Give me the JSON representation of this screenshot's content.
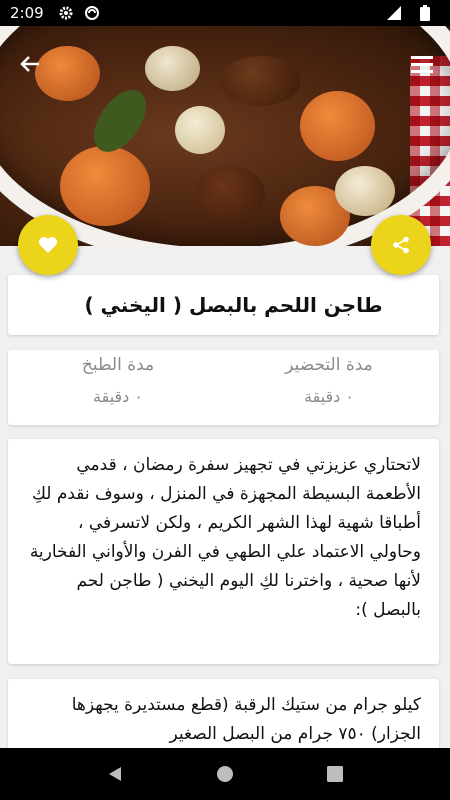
{
  "status_bar": {
    "time": "2:09",
    "icons": [
      "gear-icon",
      "sync-icon",
      "signal-icon",
      "battery-icon"
    ]
  },
  "hero": {
    "image": "beef-stew-photo",
    "back_icon": "arrow-left-icon",
    "menu_icon": "hamburger-menu-icon"
  },
  "actions": {
    "favorite_icon": "heart-icon",
    "share_icon": "share-icon",
    "accent_color": "#ecd41a"
  },
  "recipe": {
    "title": "طاجن اللحم بالبصل ( اليخني )",
    "prep_label": "مدة التحضير",
    "prep_value": "٠ دقيقة",
    "cook_label": "مدة الطبخ",
    "cook_value": "٠ دقيقة",
    "description": "لاتحتاري عزيزتي في تجهيز سفرة رمضان ، قدمي الأطعمة البسيطة المجهزة في المنزل ، وسوف نقدم لكِ أطباقا شهية لهذا الشهر الكريم ، ولكن لاتسرفي ، وحاولي الاعتماد علي الطهي في الفرن والأواني الفخارية لأنها صحية ، واخترنا لكِ اليوم اليخني ( طاجن لحم بالبصل ):",
    "ingredients": "كيلو جرام من ستيك الرقبة (قطع مستديرة يجهزها الجزار) ٧٥٠ جرام من البصل الصغير"
  },
  "nav": {
    "back_icon": "nav-back-icon",
    "home_icon": "nav-home-icon",
    "recents_icon": "nav-recents-icon"
  }
}
